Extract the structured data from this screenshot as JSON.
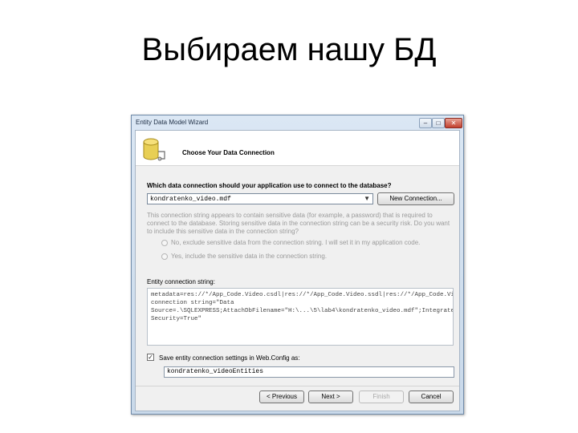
{
  "slide": {
    "title": "Выбираем нашу БД"
  },
  "window": {
    "title": "Entity Data Model Wizard",
    "controls": {
      "minimize": "–",
      "maximize": "□",
      "close": "✕"
    }
  },
  "header": {
    "heading": "Choose Your Data Connection",
    "icon": "database-icon"
  },
  "connection": {
    "question": "Which data connection should your application use to connect to the database?",
    "selected": "kondratenko_video.mdf",
    "new_connection_label": "New Connection..."
  },
  "sensitive": {
    "info_line1": "This connection string appears to contain sensitive data (for example, a password) that is required to",
    "info_line2": "connect to the database. Storing sensitive data in the connection string can be a security risk. Do you want",
    "info_line3": "to include this sensitive data in the connection string?",
    "option_no": "No, exclude sensitive data from the connection string. I will set it in my application code.",
    "option_yes": "Yes, include the sensitive data in the connection string."
  },
  "entity_connection": {
    "label": "Entity connection string:",
    "value": "metadata=res://*/App_Code.Video.csdl|res://*/App_Code.Video.ssdl|res://*/App_Code.Video.msl;provider=System.Data.SqlClient;provider connection string=\"Data Source=.\\SQLEXPRESS;AttachDbFilename=\"H:\\...\\5\\lab4\\kondratenko_video.mdf\";Integrated Security=True\""
  },
  "save_settings": {
    "checked": true,
    "check_mark": "✓",
    "label": "Save entity connection settings in Web.Config as:",
    "value": "kondratenko_videoEntities"
  },
  "footer": {
    "previous": "< Previous",
    "next": "Next >",
    "finish": "Finish",
    "cancel": "Cancel"
  }
}
